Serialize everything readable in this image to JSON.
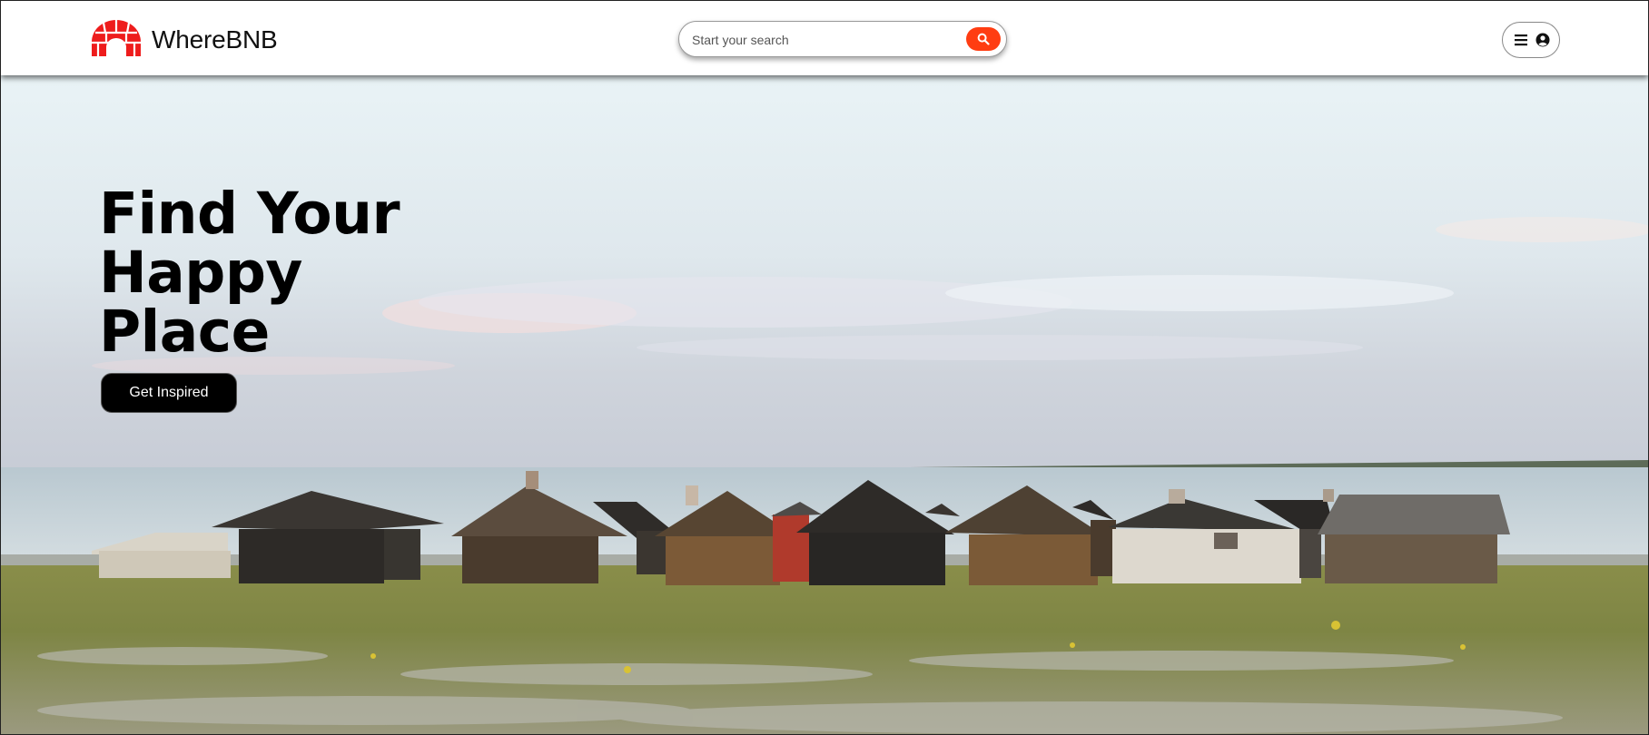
{
  "header": {
    "brand": "WhereBNB",
    "search": {
      "placeholder": "Start your search"
    }
  },
  "hero": {
    "headline_lines": [
      "Find Your",
      "Happy",
      "Place"
    ],
    "cta_label": "Get Inspired"
  },
  "colors": {
    "accent": "#ff3d12",
    "logo": "#ee1c1c",
    "cta_bg": "#000000"
  },
  "icons": {
    "logo": "igloo-logo-icon",
    "search": "search-icon",
    "menu": "menu-icon",
    "user": "user-circle-icon"
  }
}
